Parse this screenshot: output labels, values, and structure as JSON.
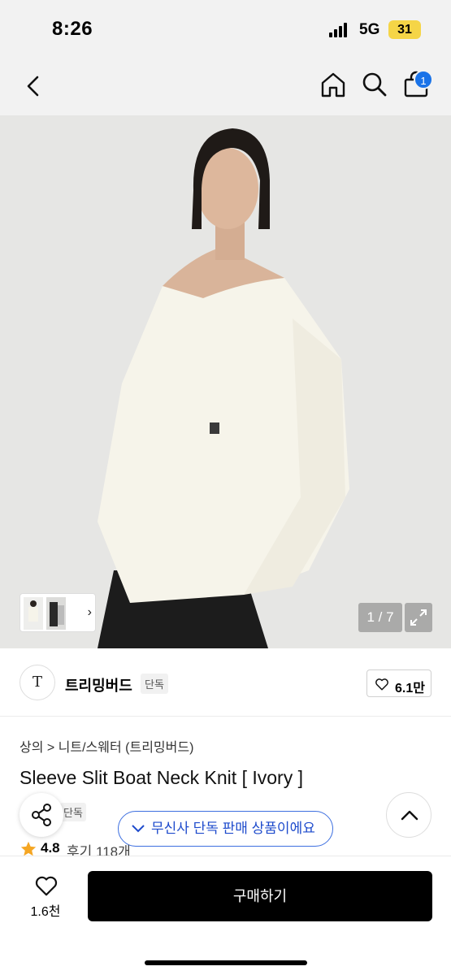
{
  "status_bar": {
    "time": "8:26",
    "network": "5G",
    "battery": "31"
  },
  "nav": {
    "back_icon": "chevron-left-icon",
    "home_icon": "home-icon",
    "search_icon": "search-icon",
    "cart_icon": "bag-icon",
    "cart_count": "1",
    "badge_color": "#1a73e8"
  },
  "gallery": {
    "counter": "1 / 7",
    "expand_icon": "expand-icon"
  },
  "brand": {
    "logo": "T",
    "name": "트리밍버드",
    "tag": "단독",
    "like_count": "6.1만"
  },
  "product": {
    "breadcrumb": "상의 > 니트/스웨터 (트리밍버드)",
    "title": "Sleeve Slit Boat Neck Knit [ Ivory ]",
    "exclusive": "단독",
    "rating": "4.8",
    "reviews": "후기 118개"
  },
  "toast": {
    "text": "무신사 단독 판매 상품이에요",
    "color": "#1e4bcc"
  },
  "bottom": {
    "fav_count": "1.6천",
    "buy_label": "구매하기"
  }
}
